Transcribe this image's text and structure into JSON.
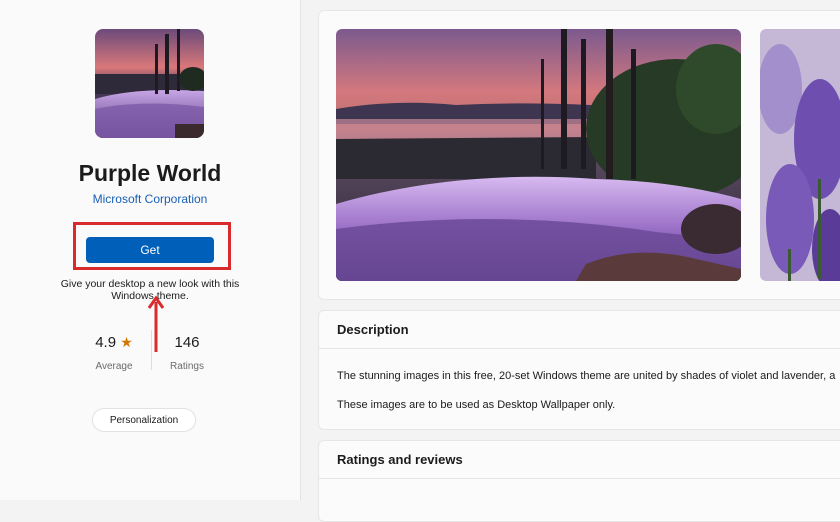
{
  "app": {
    "title": "Purple World",
    "publisher": "Microsoft Corporation",
    "get_label": "Get",
    "get_description": "Give your desktop a new look with this Windows theme."
  },
  "rating": {
    "average_value": "4.9",
    "average_label": "Average",
    "count_value": "146",
    "count_label": "Ratings"
  },
  "category": "Personalization",
  "description": {
    "title": "Description",
    "line1": "The stunning images in this free, 20-set Windows theme are united by shades of violet and lavender, a",
    "line2": "These images are to be used as Desktop Wallpaper only."
  },
  "reviews": {
    "title": "Ratings and reviews"
  },
  "colors": {
    "accent": "#005fb8",
    "highlight": "#d92b2b",
    "star": "#d47700"
  }
}
